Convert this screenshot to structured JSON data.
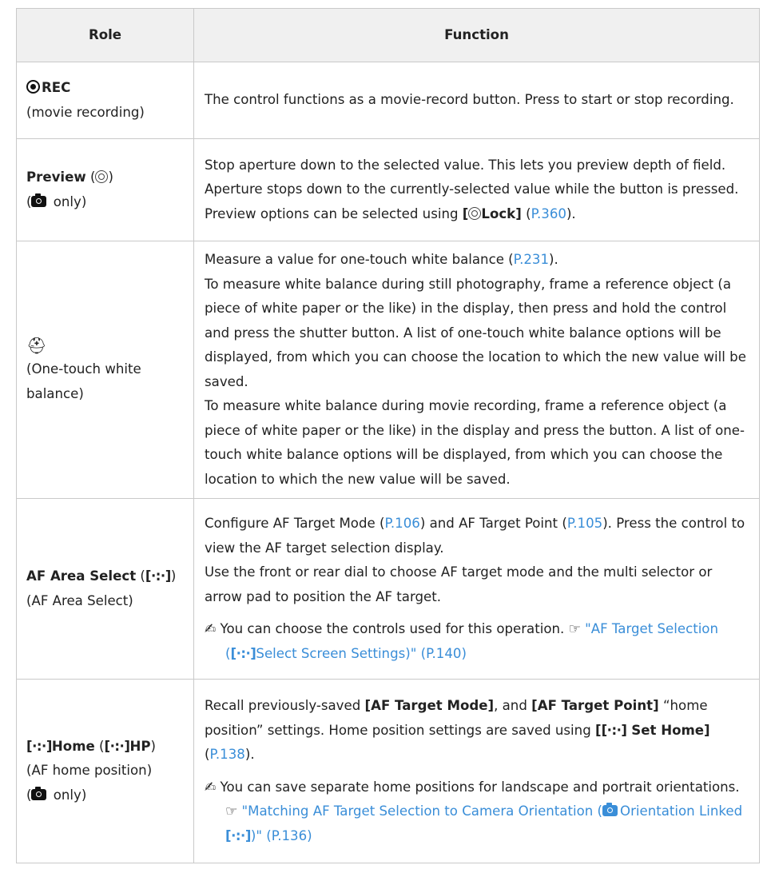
{
  "header": {
    "role": "Role",
    "function": "Function"
  },
  "rows": [
    {
      "rec_label": "REC",
      "role_sub": "(movie recording)",
      "func": "The control functions as a movie-record button. Press to start or stop recording."
    },
    {
      "role_bold": "Preview",
      "role_sub_open": "(",
      "role_sub_close": " only)",
      "func_a": "Stop aperture down to the selected value. This lets you preview depth of field. Aperture stops down to the currently-selected value while the button is pressed. Preview options can be selected using ",
      "func_bold": "Lock]",
      "func_link": "P.360"
    },
    {
      "role_sub": "(One-touch white balance)",
      "func_1a": "Measure a value for one-touch white balance (",
      "func_1link": "P.231",
      "func_1b": ").",
      "func_2": "To measure white balance during still photography, frame a reference object (a piece of white paper or the like) in the display, then press and hold the control and press the shutter button. A list of one-touch white balance options will be displayed, from which you can choose the location to which the new value will be saved.",
      "func_3": "To measure white balance during movie recording, frame a reference object (a piece of white paper or the like) in the display and press the button. A list of one-touch white balance options will be displayed, from which you can choose the location to which the new value will be saved."
    },
    {
      "role_bold": "AF Area Select",
      "role_sub": "(AF Area Select)",
      "func_1a": "Configure AF Target Mode (",
      "func_1link1": "P.106",
      "func_1b": ") and AF Target Point (",
      "func_1link2": "P.105",
      "func_1c": "). Press the control to view the AF target selection display.",
      "func_2": "Use the front or rear dial to choose AF target mode and the multi selector or arrow pad to position the AF target.",
      "note_text": "You can choose the controls used for this operation.",
      "note_link_a": "\"AF Target Selection (",
      "note_link_b": "Select Screen Settings)\" (P.140)"
    },
    {
      "role_bold_home": "Home",
      "role_bold_hp": "HP",
      "role_sub": "(AF home position)",
      "role_sub2_close": " only)",
      "func_a": "Recall previously-saved ",
      "func_b1": "[AF Target Mode]",
      "func_c": ", and ",
      "func_b2": "[AF Target Point]",
      "func_d": " “home position” settings. Home position settings are saved using ",
      "func_b3": "Set Home]",
      "func_e": " (",
      "func_link": "P.138",
      "func_f": ").",
      "note_text": "You can save separate home positions for landscape and portrait orientations.",
      "note_link_a": "\"Matching AF Target Selection to Camera Orientation (",
      "note_link_b": "Orientation Linked ",
      "note_link_c": ")\" (P.136)"
    }
  ],
  "symbols": {
    "af_area": "[·:·]",
    "ref_mark": "☞",
    "pen_mark": "✍",
    "one_touch": "⛑"
  },
  "colors": {
    "link": "#3a8ed8",
    "header_bg": "#f0f0f0",
    "border": "#c9c9c9"
  }
}
